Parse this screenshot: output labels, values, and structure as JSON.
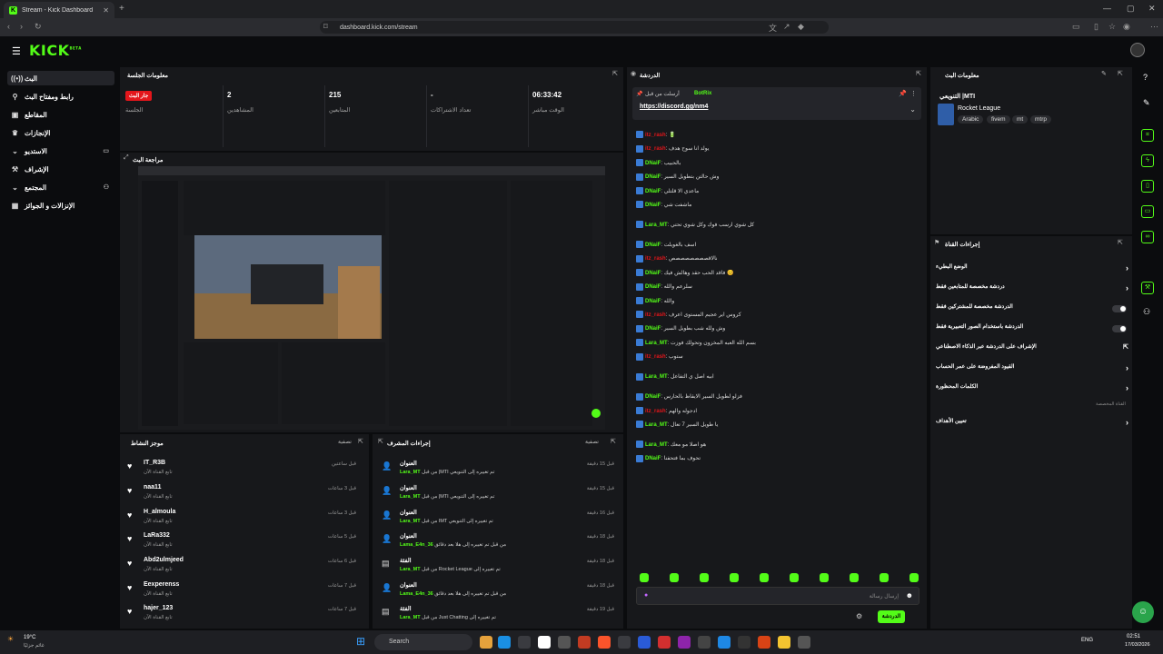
{
  "browser": {
    "tab_title": "Stream - Kick Dashboard",
    "url": "dashboard.kick.com/stream"
  },
  "sidebar": {
    "items": [
      {
        "label": "البث",
        "icon": "broadcast-icon"
      },
      {
        "label": "رابط ومفتاح البث",
        "icon": "link-icon"
      },
      {
        "label": "المقاطع",
        "icon": "clips-icon"
      },
      {
        "label": "الإنجازات",
        "icon": "achievements-icon"
      },
      {
        "label": "الاستديو",
        "icon": "studio-icon"
      },
      {
        "label": "الإشراف",
        "icon": "moderation-icon"
      },
      {
        "label": "المجتمع",
        "icon": "community-icon"
      },
      {
        "label": "الإنزالات و الجوائز",
        "icon": "drops-icon"
      }
    ]
  },
  "session": {
    "title": "معلومات الجلسة",
    "live_badge": "جار البث",
    "stats": [
      {
        "value": "",
        "label": "الجلسة"
      },
      {
        "value": "2",
        "label": "المشاهدين"
      },
      {
        "value": "215",
        "label": "المتابعين"
      },
      {
        "value": "-",
        "label": "تعداد الاشتراكات"
      },
      {
        "value": "06:33:42",
        "label": "الوقت مباشر"
      }
    ]
  },
  "preview": {
    "title": "مراجعة البث"
  },
  "activity": {
    "title": "موجز النشاط",
    "filter": "تصفية",
    "items": [
      {
        "name": "IT_R3B",
        "sub": "تابع القناة الآن",
        "time": "قبل ساعتين"
      },
      {
        "name": "naa11",
        "sub": "تابع القناة الآن",
        "time": "قبل 3 ساعات"
      },
      {
        "name": "H_almoula",
        "sub": "تابع القناة الآن",
        "time": "قبل 3 ساعات"
      },
      {
        "name": "LaRa332",
        "sub": "تابع القناة الآن",
        "time": "قبل 5 ساعات"
      },
      {
        "name": "Abd2ulmjeed",
        "sub": "تابع القناة الآن",
        "time": "قبل 6 ساعات"
      },
      {
        "name": "Eexperenss",
        "sub": "تابع القناة الآن",
        "time": "قبل 7 ساعات"
      },
      {
        "name": "hajer_123",
        "sub": "تابع القناة الآن",
        "time": "قبل 7 ساعات"
      }
    ]
  },
  "modactions": {
    "title": "إجراءات المشرف",
    "filter": "تصفية",
    "items": [
      {
        "t1": "العنوان",
        "user": "Lara_MT",
        "t2": "من قبل |MTI تم تغييره إلى التنويعي",
        "time": "قبل 15 دقيقة"
      },
      {
        "t1": "العنوان",
        "user": "Lara_MT",
        "t2": "من قبل |MTI تم تغييره إلى التنويعي",
        "time": "قبل 15 دقيقة"
      },
      {
        "t1": "العنوان",
        "user": "Lara_MT",
        "t2": "من قبل IMT تم تغييره إلى التنويعي",
        "time": "قبل 16 دقيقة"
      },
      {
        "t1": "العنوان",
        "user": "Lama_E4n_36",
        "t2": "من قبل تم تغييره إلى هلا بعد دقائق",
        "time": "قبل 18 دقيقة"
      },
      {
        "t1": "الفئة",
        "user": "Lara_MT",
        "t2": "من قبل Rocket League تم تغييره إلى",
        "time": "قبل 18 دقيقة"
      },
      {
        "t1": "العنوان",
        "user": "Lama_E4n_36",
        "t2": "من قبل تم تغييره إلى هلا بعد دقائق",
        "time": "قبل 18 دقيقة"
      },
      {
        "t1": "الفئة",
        "user": "Lara_MT",
        "t2": "من قبل Just Chatting تم تغييره إلى",
        "time": "قبل 19 دقيقة"
      }
    ]
  },
  "chat": {
    "title": "الدردشة",
    "pinned_user": "BotRix",
    "pinned_prefix": "أرسلت من قبل",
    "pinned_link": "https://discord.gg/nm4",
    "input_placeholder": "إرسال رسالة",
    "send_button": "الدردشة",
    "lines": [
      {
        "user": "itz_rash",
        "color": "#e4161b",
        "text": "🔋"
      },
      {
        "user": "itz_rash",
        "color": "#e4161b",
        "text": "يولد انا سوح هدف"
      },
      {
        "user": "DNaiF",
        "color": "#53fc18",
        "text": "بالحبيب"
      },
      {
        "user": "DNaiF",
        "color": "#53fc18",
        "text": "وش حالتن بتطويل السير"
      },
      {
        "user": "DNaiF",
        "color": "#53fc18",
        "text": "ماعدي الا قلتلي"
      },
      {
        "user": "DNaiF",
        "color": "#53fc18",
        "text": "ماشفت شي"
      },
      {
        "user": "Lara_MT",
        "color": "#53fc18",
        "text": "كل شوي ارسب فوك وكل شوي تحتي"
      },
      {
        "user": "DNaiF",
        "color": "#53fc18",
        "text": "اسف بالغويلت"
      },
      {
        "user": "itz_rash",
        "color": "#e4161b",
        "text": "نالاقصصصصصصصص"
      },
      {
        "user": "DNaiF",
        "color": "#53fc18",
        "text": "فاقد الحب حقد وهالش فيك 😊"
      },
      {
        "user": "DNaiF",
        "color": "#53fc18",
        "text": "سلرعم والله"
      },
      {
        "user": "DNaiF",
        "color": "#53fc18",
        "text": "والله"
      },
      {
        "user": "itz_rash",
        "color": "#e4161b",
        "text": "كروس اير عجيم المستوى اعرف"
      },
      {
        "user": "DNaiF",
        "color": "#53fc18",
        "text": "وش ولله شب بطويل السير"
      },
      {
        "user": "Lara_MT",
        "color": "#53fc18",
        "text": "بسم الله العبه المخزون وتحولك فوزت"
      },
      {
        "user": "itz_rash",
        "color": "#e4161b",
        "text": "ستوب"
      },
      {
        "user": "Lara_MT",
        "color": "#53fc18",
        "text": "ابيه اصل ي التفاعل"
      },
      {
        "user": "DNaiF",
        "color": "#53fc18",
        "text": "فزلو لطويل السير الايقاظ بالحارس"
      },
      {
        "user": "itz_rash",
        "color": "#e4161b",
        "text": "ادجوله والهم"
      },
      {
        "user": "Lara_MT",
        "color": "#53fc18",
        "text": "يا طويل السير 7 تعال"
      },
      {
        "user": "Lara_MT",
        "color": "#53fc18",
        "text": "هو اصلا مو معك"
      },
      {
        "user": "DNaiF",
        "color": "#53fc18",
        "text": "تحوف بما فتحفنا"
      }
    ]
  },
  "stream_info": {
    "title": "معلومات البث",
    "stream_title": "التنويعي |MTI",
    "category": "Rocket League",
    "tags": [
      "Arabic",
      "fivem",
      "mt",
      "mtrp"
    ]
  },
  "channel_actions": {
    "title": "إجراءات القناة",
    "items": [
      {
        "label": "الوضع البطيء",
        "control": "chevron"
      },
      {
        "label": "دردشة مخصصة للمتابعين فقط",
        "control": "chevron"
      },
      {
        "label": "الدردشة مخصصة للمشتركين فقط",
        "control": "toggle"
      },
      {
        "label": "الدردشة باستخدام الصور التعبيرية فقط",
        "control": "toggle"
      },
      {
        "label": "الإشراف على الدردشة عبر الذكاء الاصطناعي",
        "control": "external"
      },
      {
        "label": "القيود المفروضة على عمر الحساب",
        "control": "chevron"
      },
      {
        "label": "الكلمات المحظورة",
        "control": "chevron"
      }
    ],
    "section_label": "القناة المخصصة",
    "extra_item": "تعيين الأهداف"
  },
  "taskbar": {
    "weather_temp": "19°C",
    "weather_text": "غائم جزئيًا",
    "search_placeholder": "Search",
    "lang": "ENG",
    "time": "02:51",
    "date": "17/03/2026"
  },
  "colors": {
    "accent": "#53fc18",
    "live": "#e4161b",
    "panel": "#17181b",
    "bg": "#0b0c0e"
  }
}
